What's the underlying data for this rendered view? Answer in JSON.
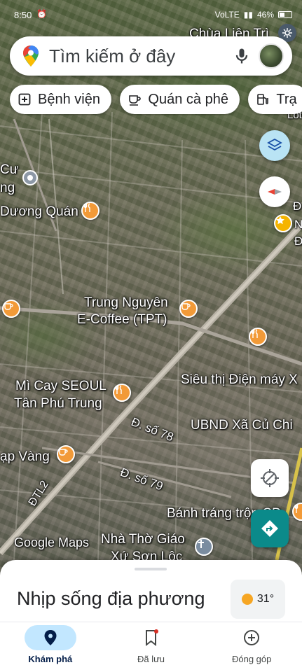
{
  "status_bar": {
    "time": "8:50",
    "network": "VoLTE",
    "battery": "46%",
    "battery_level": 0.46
  },
  "search": {
    "placeholder": "Tìm kiếm ở đây"
  },
  "chips": [
    {
      "label": "Bệnh viện",
      "icon": "hospital-icon"
    },
    {
      "label": "Quán cà phê",
      "icon": "coffee-icon"
    },
    {
      "label": "Trạ",
      "icon": "gas-station-icon"
    }
  ],
  "map": {
    "labels": {
      "chua_lien_tri": "Chùa Liên Trì",
      "lotus": "Lotus",
      "cu": "Cư",
      "ng": "ng",
      "duong_quan": "Dương Quán",
      "d": "Đ",
      "n": "N",
      "d2": "Đ",
      "trung_nguyen_1": "Trung Nguyên",
      "trung_nguyen_2": "E-Coffee (TPT)",
      "sieu_thi": "Siêu thị Điện máy X",
      "mi_cay_1": "Mì Cay SEOUL",
      "mi_cay_2": "Tân Phú Trung",
      "duong_78": "Đ. số 78",
      "ubnd": "UBND Xã Củ Chi",
      "ap_vang": "ạp Vàng",
      "duong_79": "Đ. số 79",
      "dtl2": "ĐTL2",
      "banh_trang": "Bánh tráng trộn CD",
      "google_maps": "Google Maps",
      "nha_tho_1": "Nhà Thờ Giáo",
      "nha_tho_2": "Xứ Sơn Lộc"
    }
  },
  "sheet": {
    "title": "Nhịp sống địa phương",
    "temperature": "31°"
  },
  "nav": [
    {
      "label": "Khám phá",
      "icon": "explore-pin-icon",
      "active": true
    },
    {
      "label": "Đã lưu",
      "icon": "bookmark-icon",
      "active": false
    },
    {
      "label": "Đóng góp",
      "icon": "add-circle-icon",
      "active": false
    }
  ]
}
